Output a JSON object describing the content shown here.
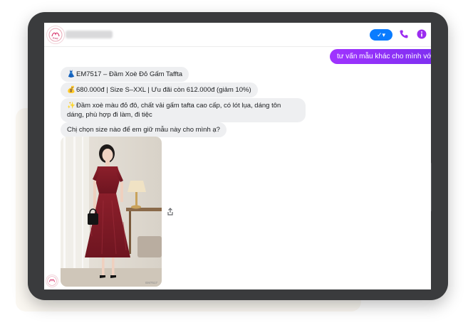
{
  "colors": {
    "accent": "#0a7cff",
    "sent_bubble": "#8a2be2",
    "received_bubble": "#eeeff1"
  },
  "header": {
    "verify_label": "✓▾",
    "icons": [
      "avatar-logo",
      "phone-icon",
      "info-icon"
    ]
  },
  "messages": {
    "sent": "tư vấn mẫu khác cho mình với",
    "received": [
      {
        "emoji": "👗",
        "text": "EM7517 – Đầm Xoè Đỏ Gấm Taffta"
      },
      {
        "emoji": "💰",
        "text": "680.000đ | Size S–XXL | Ưu đãi còn 612.000đ (giảm 10%)"
      },
      {
        "emoji": "✨",
        "text": "Đầm xoè màu đỏ đô, chất vải gấm tafta cao cấp, có lót lụa, dáng tôn dáng, phù hợp đi làm, đi tiệc"
      },
      {
        "emoji": "",
        "text": "Chị chọn size nào để em giữ mẫu này cho mình ạ?"
      }
    ],
    "image_caption": "EM7517"
  }
}
